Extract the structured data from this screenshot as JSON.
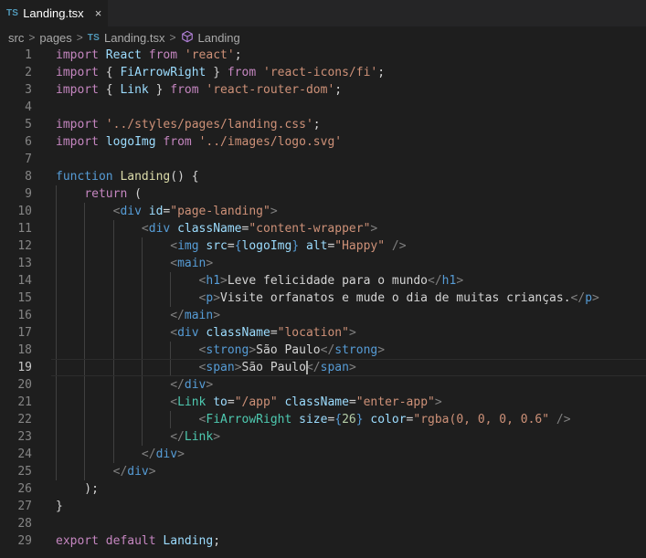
{
  "tab": {
    "lang_badge": "TS",
    "filename": "Landing.tsx",
    "close": "×"
  },
  "breadcrumb": {
    "items": [
      "src",
      "pages",
      "Landing.tsx",
      "Landing"
    ],
    "lang_badge": "TS",
    "separator": ">"
  },
  "theme": {
    "background": "#1e1e1e",
    "keyword": "#c586c0",
    "string": "#ce9178",
    "tag": "#569cd6",
    "component": "#4ec9b0",
    "attribute": "#9cdcfe",
    "function": "#dcdcaa",
    "number": "#b5cea8"
  },
  "editor": {
    "cursor": {
      "line": 19
    },
    "lines": [
      {
        "n": "1",
        "tokens": [
          [
            "kw",
            "import"
          ],
          [
            "tx",
            " "
          ],
          [
            "vr",
            "React"
          ],
          [
            "tx",
            " "
          ],
          [
            "kw",
            "from"
          ],
          [
            "tx",
            " "
          ],
          [
            "st",
            "'react'"
          ],
          [
            "tx",
            ";"
          ]
        ]
      },
      {
        "n": "2",
        "tokens": [
          [
            "kw",
            "import"
          ],
          [
            "tx",
            " { "
          ],
          [
            "vr",
            "FiArrowRight"
          ],
          [
            "tx",
            " } "
          ],
          [
            "kw",
            "from"
          ],
          [
            "tx",
            " "
          ],
          [
            "st",
            "'react-icons/fi'"
          ],
          [
            "tx",
            ";"
          ]
        ]
      },
      {
        "n": "3",
        "tokens": [
          [
            "kw",
            "import"
          ],
          [
            "tx",
            " { "
          ],
          [
            "vr",
            "Link"
          ],
          [
            "tx",
            " } "
          ],
          [
            "kw",
            "from"
          ],
          [
            "tx",
            " "
          ],
          [
            "st",
            "'react-router-dom'"
          ],
          [
            "tx",
            ";"
          ]
        ]
      },
      {
        "n": "4",
        "tokens": []
      },
      {
        "n": "5",
        "tokens": [
          [
            "kw",
            "import"
          ],
          [
            "tx",
            " "
          ],
          [
            "st",
            "'../styles/pages/landing.css'"
          ],
          [
            "tx",
            ";"
          ]
        ]
      },
      {
        "n": "6",
        "tokens": [
          [
            "kw",
            "import"
          ],
          [
            "tx",
            " "
          ],
          [
            "vr",
            "logoImg"
          ],
          [
            "tx",
            " "
          ],
          [
            "kw",
            "from"
          ],
          [
            "tx",
            " "
          ],
          [
            "st",
            "'../images/logo.svg'"
          ]
        ]
      },
      {
        "n": "7",
        "tokens": []
      },
      {
        "n": "8",
        "tokens": [
          [
            "bl",
            "function"
          ],
          [
            "tx",
            " "
          ],
          [
            "fn",
            "Landing"
          ],
          [
            "tx",
            "() {"
          ]
        ]
      },
      {
        "n": "9",
        "tokens": [
          [
            "tx",
            "    "
          ],
          [
            "kw",
            "return"
          ],
          [
            "tx",
            " ("
          ]
        ]
      },
      {
        "n": "10",
        "tokens": [
          [
            "tx",
            "        "
          ],
          [
            "pt",
            "<"
          ],
          [
            "tg",
            "div"
          ],
          [
            "tx",
            " "
          ],
          [
            "at",
            "id"
          ],
          [
            "tx",
            "="
          ],
          [
            "st",
            "\"page-landing\""
          ],
          [
            "pt",
            ">"
          ]
        ]
      },
      {
        "n": "11",
        "tokens": [
          [
            "tx",
            "            "
          ],
          [
            "pt",
            "<"
          ],
          [
            "tg",
            "div"
          ],
          [
            "tx",
            " "
          ],
          [
            "at",
            "className"
          ],
          [
            "tx",
            "="
          ],
          [
            "st",
            "\"content-wrapper\""
          ],
          [
            "pt",
            ">"
          ]
        ]
      },
      {
        "n": "12",
        "tokens": [
          [
            "tx",
            "                "
          ],
          [
            "pt",
            "<"
          ],
          [
            "tg",
            "img"
          ],
          [
            "tx",
            " "
          ],
          [
            "at",
            "src"
          ],
          [
            "tx",
            "="
          ],
          [
            "bl",
            "{"
          ],
          [
            "vr",
            "logoImg"
          ],
          [
            "bl",
            "}"
          ],
          [
            "tx",
            " "
          ],
          [
            "at",
            "alt"
          ],
          [
            "tx",
            "="
          ],
          [
            "st",
            "\"Happy\""
          ],
          [
            "tx",
            " "
          ],
          [
            "pt",
            "/>"
          ]
        ]
      },
      {
        "n": "13",
        "tokens": [
          [
            "tx",
            "                "
          ],
          [
            "pt",
            "<"
          ],
          [
            "tg",
            "main"
          ],
          [
            "pt",
            ">"
          ]
        ]
      },
      {
        "n": "14",
        "tokens": [
          [
            "tx",
            "                    "
          ],
          [
            "pt",
            "<"
          ],
          [
            "tg",
            "h1"
          ],
          [
            "pt",
            ">"
          ],
          [
            "tx",
            "Leve felicidade para o mundo"
          ],
          [
            "pt",
            "</"
          ],
          [
            "tg",
            "h1"
          ],
          [
            "pt",
            ">"
          ]
        ]
      },
      {
        "n": "15",
        "tokens": [
          [
            "tx",
            "                    "
          ],
          [
            "pt",
            "<"
          ],
          [
            "tg",
            "p"
          ],
          [
            "pt",
            ">"
          ],
          [
            "tx",
            "Visite orfanatos e mude o dia de muitas crianças."
          ],
          [
            "pt",
            "</"
          ],
          [
            "tg",
            "p"
          ],
          [
            "pt",
            ">"
          ]
        ]
      },
      {
        "n": "16",
        "tokens": [
          [
            "tx",
            "                "
          ],
          [
            "pt",
            "</"
          ],
          [
            "tg",
            "main"
          ],
          [
            "pt",
            ">"
          ]
        ]
      },
      {
        "n": "17",
        "tokens": [
          [
            "tx",
            "                "
          ],
          [
            "pt",
            "<"
          ],
          [
            "tg",
            "div"
          ],
          [
            "tx",
            " "
          ],
          [
            "at",
            "className"
          ],
          [
            "tx",
            "="
          ],
          [
            "st",
            "\"location\""
          ],
          [
            "pt",
            ">"
          ]
        ]
      },
      {
        "n": "18",
        "tokens": [
          [
            "tx",
            "                    "
          ],
          [
            "pt",
            "<"
          ],
          [
            "tg",
            "strong"
          ],
          [
            "pt",
            ">"
          ],
          [
            "tx",
            "São Paulo"
          ],
          [
            "pt",
            "</"
          ],
          [
            "tg",
            "strong"
          ],
          [
            "pt",
            ">"
          ]
        ]
      },
      {
        "n": "19",
        "tokens": [
          [
            "tx",
            "                    "
          ],
          [
            "pt",
            "<"
          ],
          [
            "tg",
            "span"
          ],
          [
            "pt",
            ">"
          ],
          [
            "tx",
            "São Paulo"
          ],
          [
            "pt",
            "</"
          ],
          [
            "tg",
            "span"
          ],
          [
            "pt",
            ">"
          ]
        ]
      },
      {
        "n": "20",
        "tokens": [
          [
            "tx",
            "                "
          ],
          [
            "pt",
            "</"
          ],
          [
            "tg",
            "div"
          ],
          [
            "pt",
            ">"
          ]
        ]
      },
      {
        "n": "21",
        "tokens": [
          [
            "tx",
            "                "
          ],
          [
            "pt",
            "<"
          ],
          [
            "cp",
            "Link"
          ],
          [
            "tx",
            " "
          ],
          [
            "at",
            "to"
          ],
          [
            "tx",
            "="
          ],
          [
            "st",
            "\"/app\""
          ],
          [
            "tx",
            " "
          ],
          [
            "at",
            "className"
          ],
          [
            "tx",
            "="
          ],
          [
            "st",
            "\"enter-app\""
          ],
          [
            "pt",
            ">"
          ]
        ]
      },
      {
        "n": "22",
        "tokens": [
          [
            "tx",
            "                    "
          ],
          [
            "pt",
            "<"
          ],
          [
            "cp",
            "FiArrowRight"
          ],
          [
            "tx",
            " "
          ],
          [
            "at",
            "size"
          ],
          [
            "tx",
            "="
          ],
          [
            "bl",
            "{"
          ],
          [
            "nm",
            "26"
          ],
          [
            "bl",
            "}"
          ],
          [
            "tx",
            " "
          ],
          [
            "at",
            "color"
          ],
          [
            "tx",
            "="
          ],
          [
            "st",
            "\"rgba(0, 0, 0, 0.6\""
          ],
          [
            "tx",
            " "
          ],
          [
            "pt",
            "/>"
          ]
        ]
      },
      {
        "n": "23",
        "tokens": [
          [
            "tx",
            "                "
          ],
          [
            "pt",
            "</"
          ],
          [
            "cp",
            "Link"
          ],
          [
            "pt",
            ">"
          ]
        ]
      },
      {
        "n": "24",
        "tokens": [
          [
            "tx",
            "            "
          ],
          [
            "pt",
            "</"
          ],
          [
            "tg",
            "div"
          ],
          [
            "pt",
            ">"
          ]
        ]
      },
      {
        "n": "25",
        "tokens": [
          [
            "tx",
            "        "
          ],
          [
            "pt",
            "</"
          ],
          [
            "tg",
            "div"
          ],
          [
            "pt",
            ">"
          ]
        ]
      },
      {
        "n": "26",
        "tokens": [
          [
            "tx",
            "    );"
          ]
        ]
      },
      {
        "n": "27",
        "tokens": [
          [
            "tx",
            "}"
          ]
        ]
      },
      {
        "n": "28",
        "tokens": []
      },
      {
        "n": "29",
        "tokens": [
          [
            "kw",
            "export"
          ],
          [
            "tx",
            " "
          ],
          [
            "kw",
            "default"
          ],
          [
            "tx",
            " "
          ],
          [
            "vr",
            "Landing"
          ],
          [
            "tx",
            ";"
          ]
        ]
      }
    ]
  }
}
